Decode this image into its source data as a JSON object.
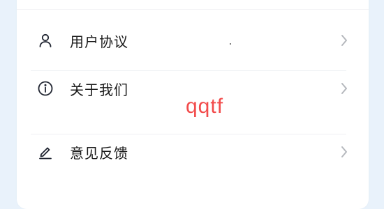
{
  "settings_menu": {
    "items": [
      {
        "label": "用户协议",
        "icon": "user-icon"
      },
      {
        "label": "关于我们",
        "icon": "info-circle-icon"
      },
      {
        "label": "意见反馈",
        "icon": "edit-pen-icon"
      }
    ],
    "chevron_icon": "chevron-right-icon"
  },
  "overlay": {
    "watermark_text": "qqtf"
  },
  "colors": {
    "page_background": "#e9f2fb",
    "card_background": "#ffffff",
    "text": "#1a1a1a",
    "chevron": "#b5b8bd",
    "divider": "#eef0f3",
    "watermark": "#f24b4b"
  }
}
